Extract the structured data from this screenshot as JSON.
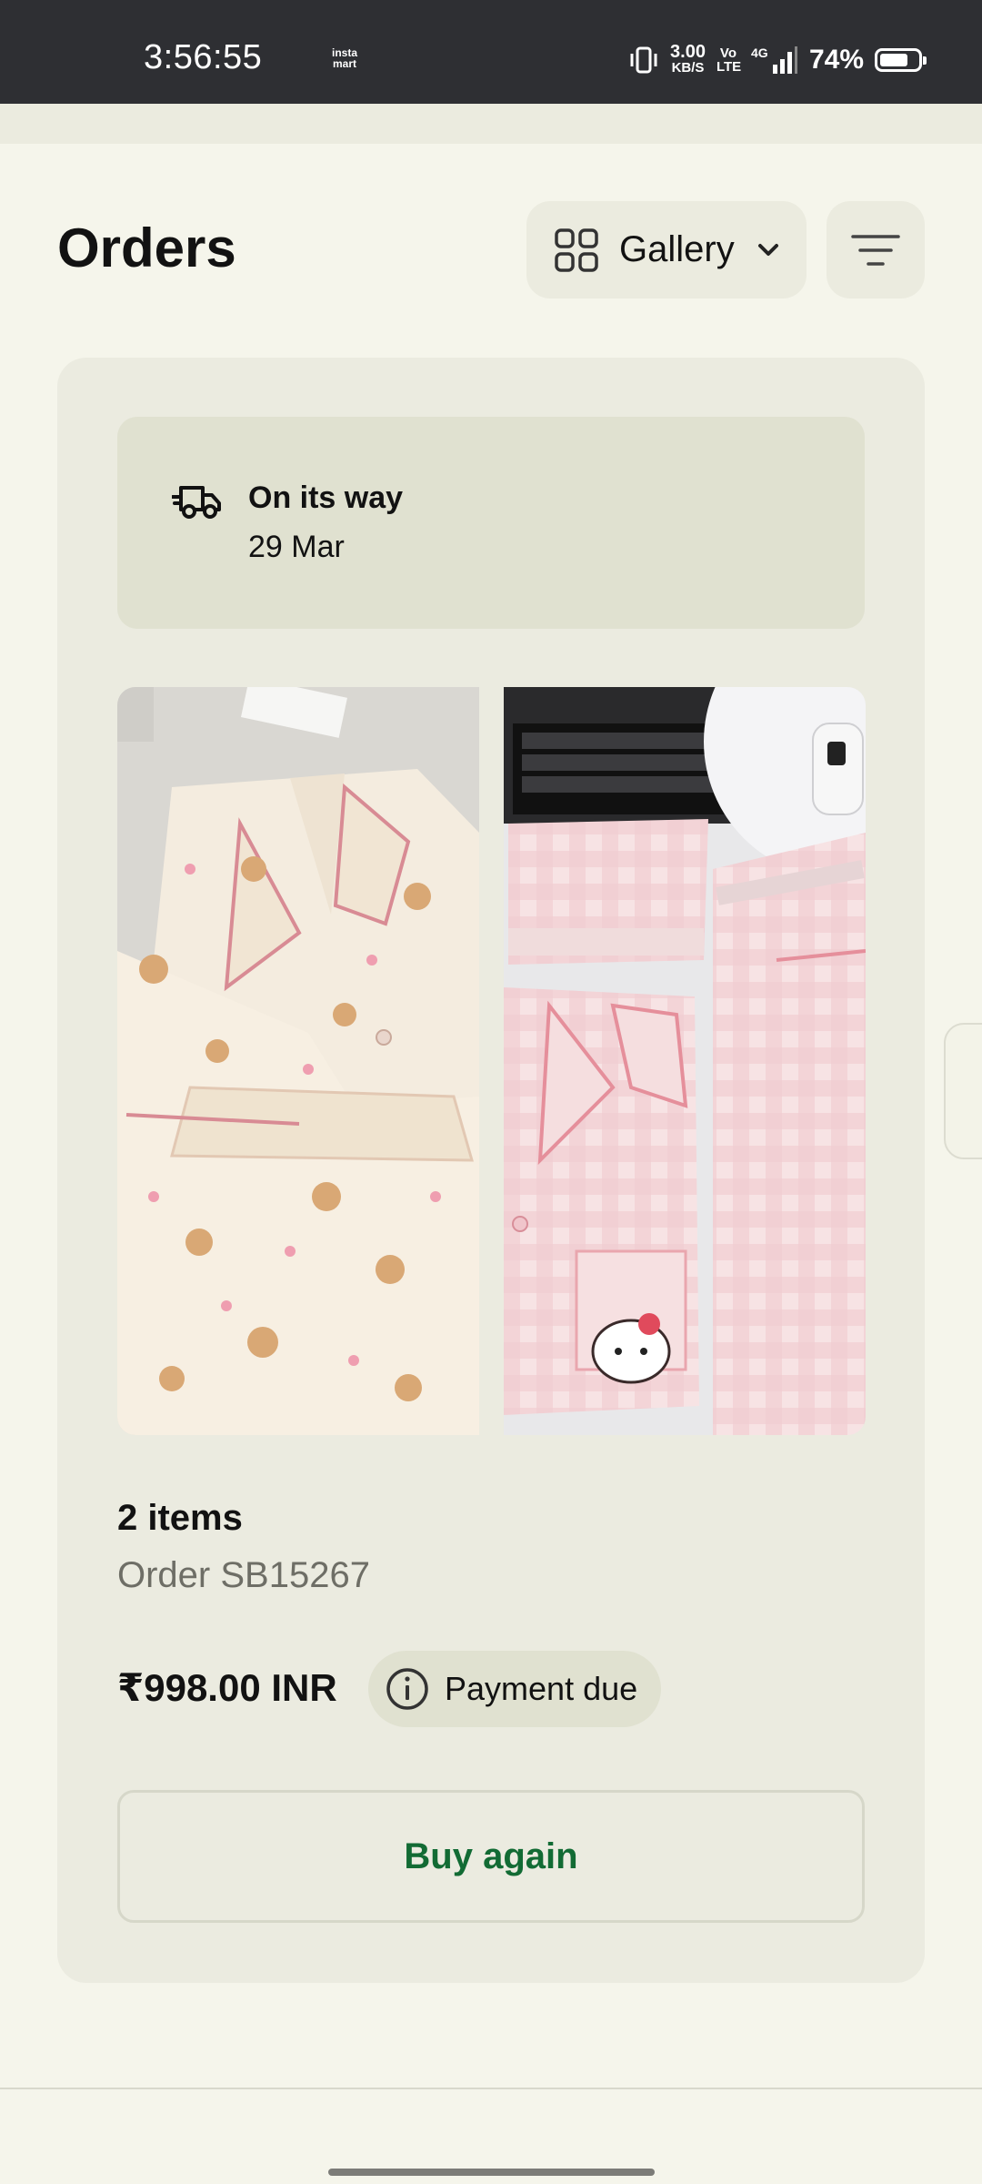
{
  "status_bar": {
    "time": "3:56:55",
    "app_icon_text": "insta mart",
    "net_speed_value": "3.00",
    "net_speed_unit": "KB/S",
    "volte": "Vo LTE",
    "network": "4G",
    "battery_percent": "74%",
    "battery_level": 0.74
  },
  "header": {
    "title": "Orders",
    "view_selector_label": "Gallery",
    "view_icon": "grid-icon",
    "dropdown_icon": "chevron-down-icon",
    "filter_icon": "filter-icon"
  },
  "order": {
    "status_icon": "delivery-truck-icon",
    "status_label": "On its way",
    "status_date": "29 Mar",
    "items_count": "2 items",
    "order_id": "Order SB15267",
    "price": "₹998.00 INR",
    "payment_status": "Payment due",
    "payment_icon": "info-icon",
    "buy_again_label": "Buy again",
    "products": [
      {
        "image": "cream teddy-print pajama set"
      },
      {
        "image": "pink gingham pajama set with kitty pocket"
      }
    ]
  },
  "colors": {
    "background": "#f5f5eb",
    "card": "#ebebe0",
    "status_box": "#e0e1d0",
    "accent_green": "#126b34",
    "status_bar": "#2e2f33"
  }
}
